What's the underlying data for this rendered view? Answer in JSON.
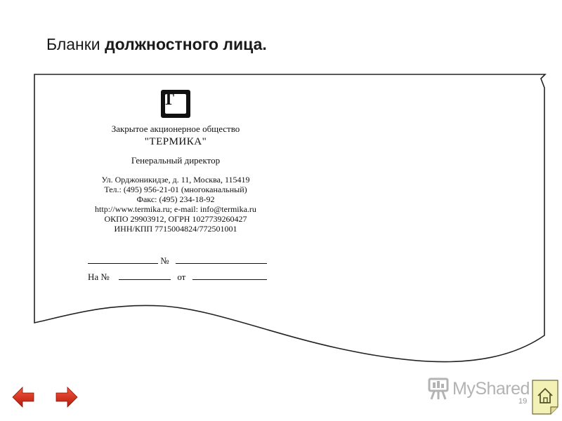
{
  "slide": {
    "title_regular": "Бланки ",
    "title_bold": "должностного лица.",
    "page_number": "19"
  },
  "letterhead": {
    "logo_letter": "T",
    "logo_mark": "®",
    "org_type": "Закрытое акционерное общество",
    "org_name": "\"ТЕРМИКА\"",
    "position": "Генеральный директор",
    "contacts": [
      "Ул. Орджоникидзе, д. 11, Москва, 115419",
      "Тел.: (495) 956-21-01 (многоканальный)",
      "Факс: (495) 234-18-92",
      "http://www.termika.ru; e-mail: info@termika.ru",
      "ОКПО 29903912, ОГРН 1027739260427",
      "ИНН/КПП 7715004824/772501001"
    ],
    "ref_number_label": "№",
    "ref_answer_label": "На №",
    "ref_date_label": "от"
  },
  "brand": {
    "name": "MyShared"
  },
  "icons": {
    "nav_back": "arrow-left-icon",
    "nav_next": "arrow-right-icon",
    "home": "home-icon",
    "brand_logo": "myshared-logo-icon"
  },
  "colors": {
    "nav_arrow": "#d42a1c",
    "brand_gray": "#b3b3b3",
    "home_note": "#f4f1b6"
  }
}
